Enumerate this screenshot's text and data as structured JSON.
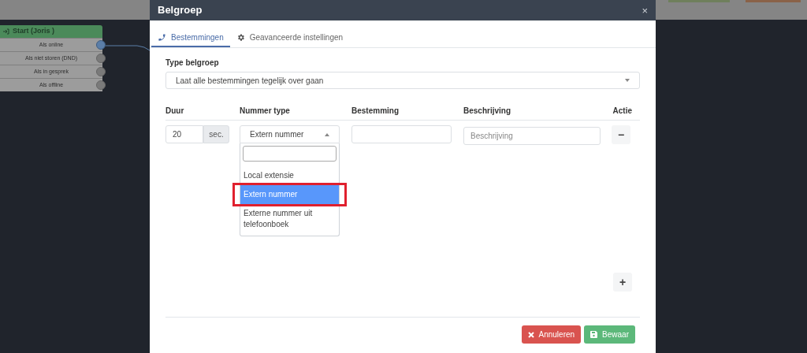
{
  "flow_node": {
    "title": "Start (Joris )",
    "outputs": [
      {
        "label": "Als online",
        "connected": true
      },
      {
        "label": "Als niet storen (DND)",
        "connected": false
      },
      {
        "label": "Als in gesprek",
        "connected": false
      },
      {
        "label": "Als offline",
        "connected": false
      }
    ]
  },
  "dialog": {
    "title": "Belgroep",
    "close": "×",
    "tabs": [
      {
        "label": "Bestemmingen",
        "selected": true
      },
      {
        "label": "Geavanceerde instellingen",
        "selected": false
      }
    ],
    "type_label": "Type belgroep",
    "type_value": "Laat alle bestemmingen tegelijk over gaan",
    "columns": [
      "Duur",
      "Nummer type",
      "Bestemming",
      "Beschrijving",
      "Actie"
    ],
    "row": {
      "duration": "20",
      "unit": "sec.",
      "number_type": "Extern nummer",
      "description_placeholder": "Beschrijving",
      "remove": "−"
    },
    "dropdown": {
      "expanded": true,
      "options": [
        {
          "label": "Local extensie",
          "selected": false,
          "outlined": false
        },
        {
          "label": "Extern nummer",
          "selected": true,
          "outlined": true
        },
        {
          "label": "Externe nummer uit telefoonboek",
          "selected": false,
          "outlined": false
        }
      ]
    },
    "add": "+",
    "buttons": [
      {
        "label": "Annuleren",
        "kind": "cancel"
      },
      {
        "label": "Bewaar",
        "kind": "save"
      }
    ]
  }
}
